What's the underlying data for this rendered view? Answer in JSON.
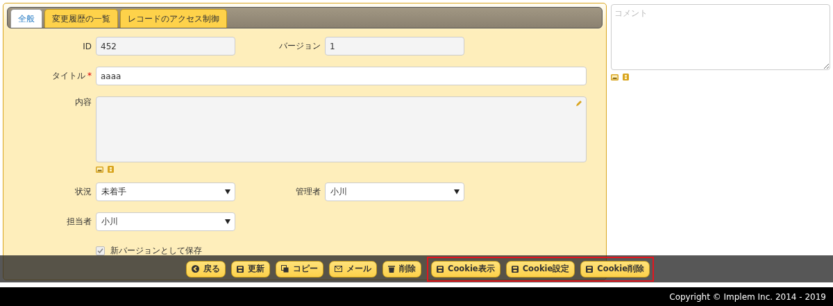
{
  "tabs": [
    {
      "label": "全般",
      "selected": true
    },
    {
      "label": "変更履歴の一覧",
      "selected": false
    },
    {
      "label": "レコードのアクセス制御",
      "selected": false
    }
  ],
  "fields": {
    "id": {
      "label": "ID",
      "value": "452"
    },
    "version": {
      "label": "バージョン",
      "value": "1"
    },
    "title": {
      "label": "タイトル",
      "value": "aaaa",
      "required_mark": "*"
    },
    "body": {
      "label": "内容"
    },
    "status": {
      "label": "状況",
      "value": "未着手"
    },
    "manager": {
      "label": "管理者",
      "value": "小川"
    },
    "owner": {
      "label": "担当者",
      "value": "小川"
    }
  },
  "save_as_new_version": {
    "label": "新バージョンとして保存",
    "checked": true,
    "disabled": true
  },
  "comment": {
    "placeholder": "コメント"
  },
  "toolbar": {
    "buttons": [
      {
        "label": "戻る",
        "kind": "back"
      },
      {
        "label": "更新",
        "kind": "save"
      },
      {
        "label": "コピー",
        "kind": "copy"
      },
      {
        "label": "メール",
        "kind": "mail"
      },
      {
        "label": "削除",
        "kind": "trash"
      }
    ],
    "highlighted_buttons": [
      {
        "label": "Cookie表示",
        "kind": "save"
      },
      {
        "label": "Cookie設定",
        "kind": "save"
      },
      {
        "label": "Cookie削除",
        "kind": "save"
      }
    ]
  },
  "footer": {
    "copyright": "Copyright © Implem Inc. 2014 - 2019"
  }
}
